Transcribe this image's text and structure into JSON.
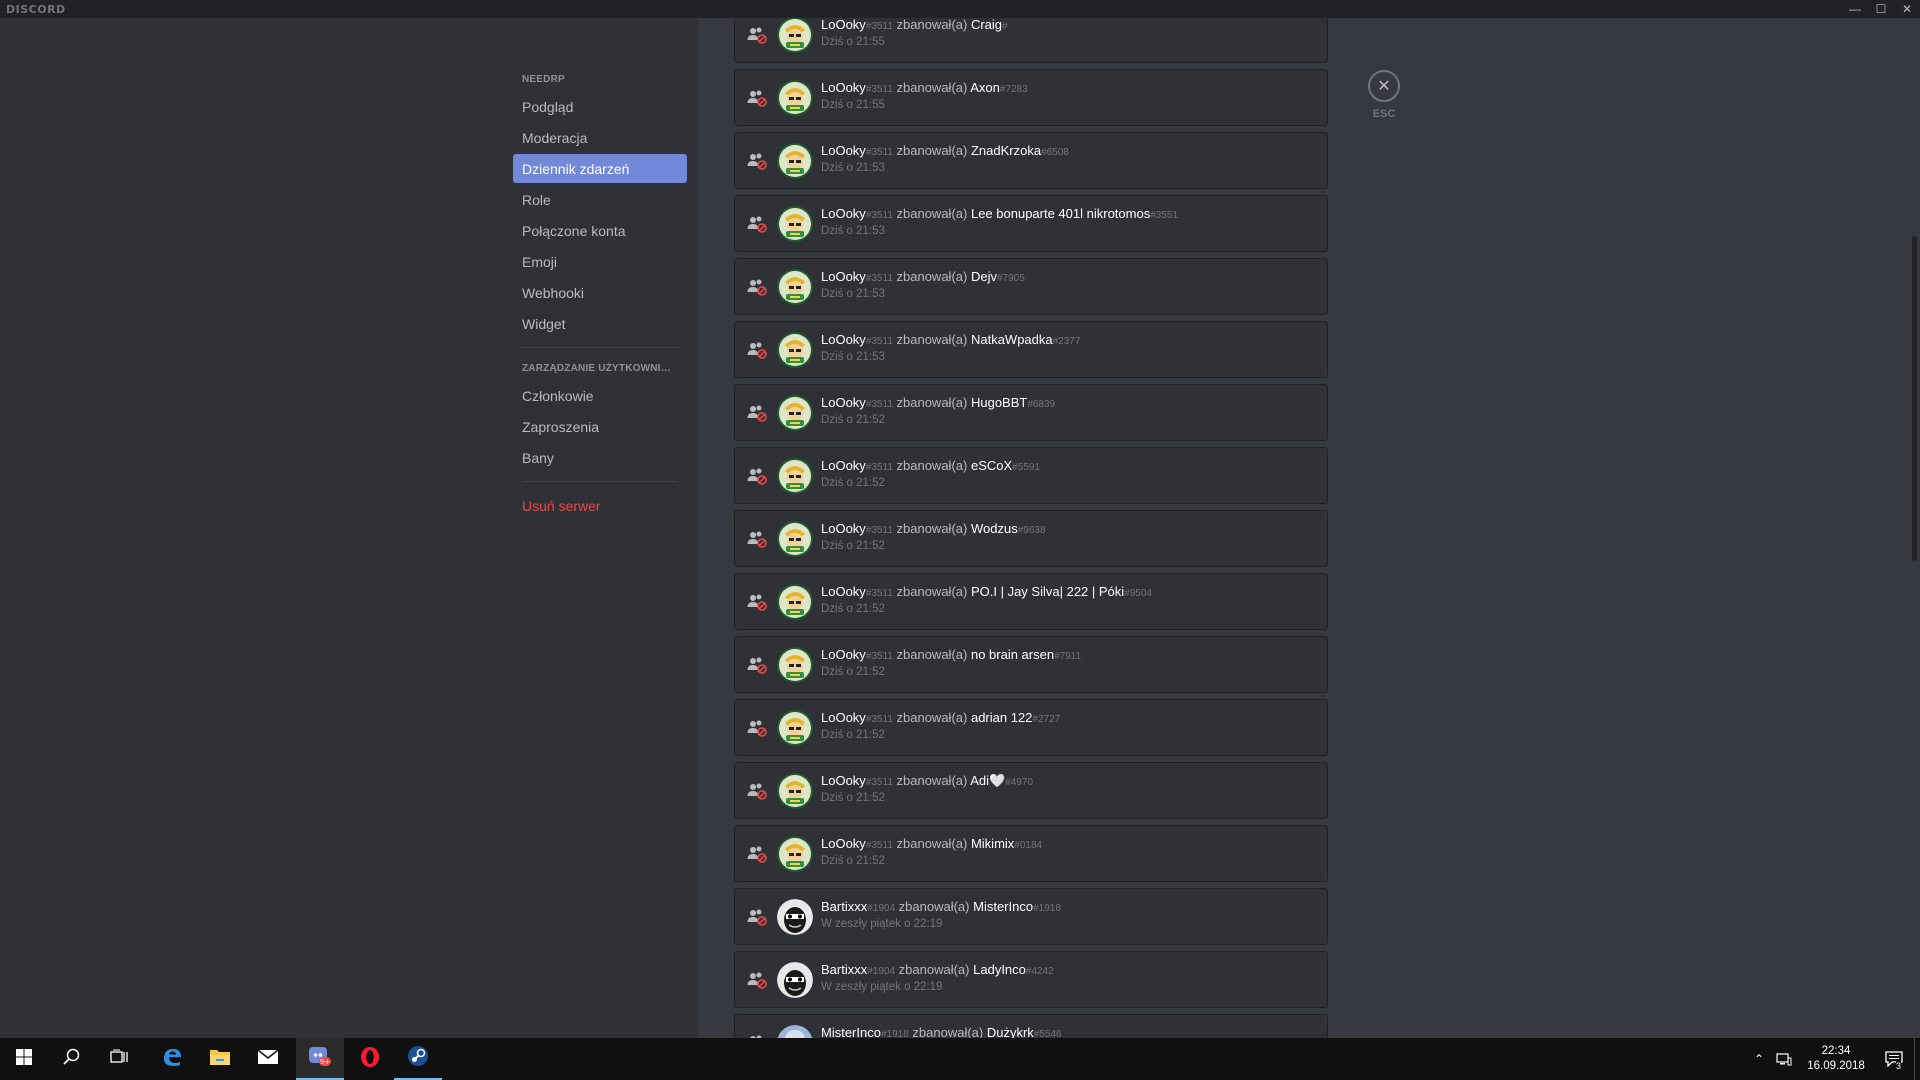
{
  "app": {
    "title": "DISCORD"
  },
  "window_controls": {
    "minimize": "—",
    "maximize": "☐",
    "close": "✕"
  },
  "sidebar": {
    "sections": [
      {
        "header": "NEEDRP",
        "items": [
          {
            "label": "Podgląd",
            "selected": false
          },
          {
            "label": "Moderacja",
            "selected": false
          },
          {
            "label": "Dziennik zdarzeń",
            "selected": true
          },
          {
            "label": "Role",
            "selected": false
          },
          {
            "label": "Połączone konta",
            "selected": false
          },
          {
            "label": "Emoji",
            "selected": false
          },
          {
            "label": "Webhooki",
            "selected": false
          },
          {
            "label": "Widget",
            "selected": false
          }
        ]
      },
      {
        "header": "ZARZĄDZANIE UŻYTKOWNIKAMI",
        "items": [
          {
            "label": "Członkowie",
            "selected": false
          },
          {
            "label": "Zaproszenia",
            "selected": false
          },
          {
            "label": "Bany",
            "selected": false
          }
        ]
      }
    ],
    "delete_server": "Usuń serwer"
  },
  "close": {
    "icon": "close-icon",
    "label": "ESC"
  },
  "audit_log": [
    {
      "actor": "LoOoky",
      "actor_disc": "#3511",
      "action": "zbanował(a)",
      "target": "Craig",
      "target_disc": "#",
      "time": "Dziś o 21:55",
      "avatar": "lofty"
    },
    {
      "actor": "LoOoky",
      "actor_disc": "#3511",
      "action": "zbanował(a)",
      "target": "Axon",
      "target_disc": "#7283",
      "time": "Dziś o 21:55",
      "avatar": "lofty"
    },
    {
      "actor": "LoOoky",
      "actor_disc": "#3511",
      "action": "zbanował(a)",
      "target": "ZnadKrzoka",
      "target_disc": "#6508",
      "time": "Dziś o 21:53",
      "avatar": "lofty"
    },
    {
      "actor": "LoOoky",
      "actor_disc": "#3511",
      "action": "zbanował(a)",
      "target": "Lee bonuparte 401l nikrotomos",
      "target_disc": "#3551",
      "time": "Dziś o 21:53",
      "avatar": "lofty"
    },
    {
      "actor": "LoOoky",
      "actor_disc": "#3511",
      "action": "zbanował(a)",
      "target": "Dejv",
      "target_disc": "#7905",
      "time": "Dziś o 21:53",
      "avatar": "lofty"
    },
    {
      "actor": "LoOoky",
      "actor_disc": "#3511",
      "action": "zbanował(a)",
      "target": "NatkaWpadka",
      "target_disc": "#2377",
      "time": "Dziś o 21:53",
      "avatar": "lofty"
    },
    {
      "actor": "LoOoky",
      "actor_disc": "#3511",
      "action": "zbanował(a)",
      "target": "HugoBBT",
      "target_disc": "#6839",
      "time": "Dziś o 21:52",
      "avatar": "lofty"
    },
    {
      "actor": "LoOoky",
      "actor_disc": "#3511",
      "action": "zbanował(a)",
      "target": "eSCoX",
      "target_disc": "#5591",
      "time": "Dziś o 21:52",
      "avatar": "lofty"
    },
    {
      "actor": "LoOoky",
      "actor_disc": "#3511",
      "action": "zbanował(a)",
      "target": "Wodzus",
      "target_disc": "#9638",
      "time": "Dziś o 21:52",
      "avatar": "lofty"
    },
    {
      "actor": "LoOoky",
      "actor_disc": "#3511",
      "action": "zbanował(a)",
      "target": "PO.I | Jay Silva| 222 | Póki",
      "target_disc": "#9504",
      "time": "Dziś o 21:52",
      "avatar": "lofty"
    },
    {
      "actor": "LoOoky",
      "actor_disc": "#3511",
      "action": "zbanował(a)",
      "target": "no brain arsen",
      "target_disc": "#7911",
      "time": "Dziś o 21:52",
      "avatar": "lofty"
    },
    {
      "actor": "LoOoky",
      "actor_disc": "#3511",
      "action": "zbanował(a)",
      "target": "adrian 122",
      "target_disc": "#2727",
      "time": "Dziś o 21:52",
      "avatar": "lofty"
    },
    {
      "actor": "LoOoky",
      "actor_disc": "#3511",
      "action": "zbanował(a)",
      "target": "Adi🤍",
      "target_disc": "#4970",
      "time": "Dziś o 21:52",
      "avatar": "lofty"
    },
    {
      "actor": "LoOoky",
      "actor_disc": "#3511",
      "action": "zbanował(a)",
      "target": "Mikimix",
      "target_disc": "#0184",
      "time": "Dziś o 21:52",
      "avatar": "lofty"
    },
    {
      "actor": "Bartixxx",
      "actor_disc": "#1904",
      "action": "zbanował(a)",
      "target": "MisterInco",
      "target_disc": "#1918",
      "time": "W zeszły piątek o 22:19",
      "avatar": "bart"
    },
    {
      "actor": "Bartixxx",
      "actor_disc": "#1904",
      "action": "zbanował(a)",
      "target": "LadyInco",
      "target_disc": "#4242",
      "time": "W zeszły piątek o 22:19",
      "avatar": "bart"
    },
    {
      "actor": "MisterInco",
      "actor_disc": "#1918",
      "action": "zbanował(a)",
      "target": "Dużykrk",
      "target_disc": "#5546",
      "time": "",
      "avatar": "mister"
    }
  ],
  "taskbar": {
    "items": [
      {
        "icon": "windows-start-icon"
      },
      {
        "icon": "search-icon"
      },
      {
        "icon": "task-view-icon"
      },
      {
        "icon": "edge-icon"
      },
      {
        "icon": "file-explorer-icon"
      },
      {
        "icon": "mail-icon"
      },
      {
        "icon": "discord-icon",
        "badge": "9+"
      },
      {
        "icon": "opera-icon"
      },
      {
        "icon": "steam-icon"
      }
    ],
    "clock": {
      "time": "22:34",
      "date": "16.09.2018"
    },
    "notification_count": "3"
  },
  "colors": {
    "accent": "#7289da",
    "danger": "#f04747",
    "content_bg": "#36393f",
    "sidebar_bg": "#2f3136"
  }
}
